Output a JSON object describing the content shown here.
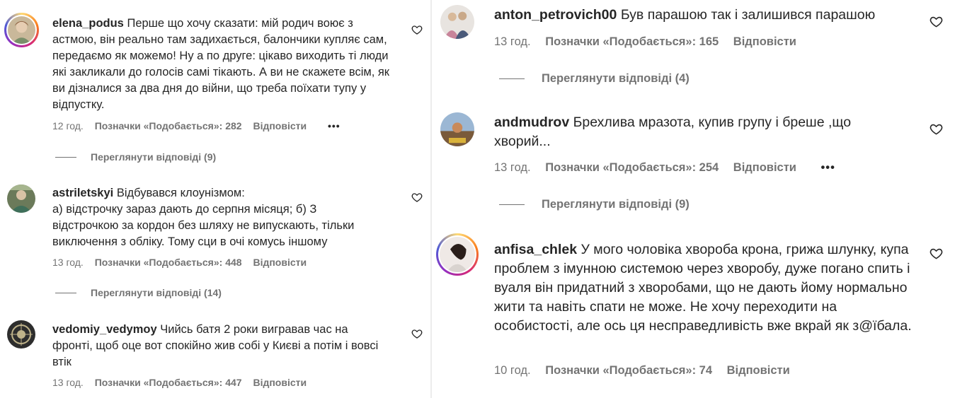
{
  "left": {
    "comments": [
      {
        "username": "elena_podus",
        "text": "Перше що хочу сказати: мій родич воює з астмою, він реально там задихається, балончики купляє сам, передаємо як можемо! Ну а по друге: цікаво виходить ті люди які закликали до голосів самі тікають. А ви не скажете всім, як ви дізналися за два дня до війни, що треба поїхати тупу у відпустку.",
        "time": "12 год.",
        "likes": "Позначки «Подобається»: 282",
        "reply": "Відповісти",
        "more": "•••",
        "view_replies": "Переглянути відповіді (9)"
      },
      {
        "username": "astriletskyi",
        "text": "Відбувався клоунізмом:",
        "text2": "а) відстрочку зараз дають до серпня місяця; б) З відстрочкою за кордон без шляху не випускають, тільки виключення з обліку. Тому сци в очі комусь іншому",
        "time": "13 год.",
        "likes": "Позначки «Подобається»: 448",
        "reply": "Відповісти",
        "view_replies": "Переглянути відповіді (14)"
      },
      {
        "username": "vedomiy_vedymoy",
        "text": "Чийсь батя 2 роки вигравав час на фронті, щоб оце вот спокійно жив собі у Києві а потім і вовсі втік",
        "time": "13 год.",
        "likes": "Позначки «Подобається»: 447",
        "reply": "Відповісти"
      }
    ]
  },
  "right": {
    "comments": [
      {
        "username": "anton_petrovich00",
        "text": "Був парашою так і залишився парашою",
        "time": "13 год.",
        "likes": "Позначки «Подобається»: 165",
        "reply": "Відповісти",
        "view_replies": "Переглянути відповіді (4)"
      },
      {
        "username": "andmudrov",
        "text": "Брехлива мразота, купив групу і бреше ,що хворий...",
        "time": "13 год.",
        "likes": "Позначки «Подобається»: 254",
        "reply": "Відповісти",
        "more": "•••",
        "view_replies": "Переглянути відповіді (9)"
      },
      {
        "username": "anfisa_chlek",
        "text": "У мого чоловіка хвороба крона, грижа шлунку, купа проблем з імунною системою через хворобу, дуже погано спить і вуаля він придатний з хворобами, що не дають йому нормально жити та навіть спати не може. Не хочу переходити на особистості, але ось ця несправедливість вже вкрай як з@їбала.",
        "time": "10 год.",
        "likes": "Позначки «Подобається»: 74",
        "reply": "Відповісти"
      }
    ]
  },
  "colors": {
    "text": "#262626",
    "secondary": "#737373",
    "story_ring": "#d62976"
  },
  "icons": {
    "like": "heart-icon",
    "more": "more-options-icon"
  }
}
